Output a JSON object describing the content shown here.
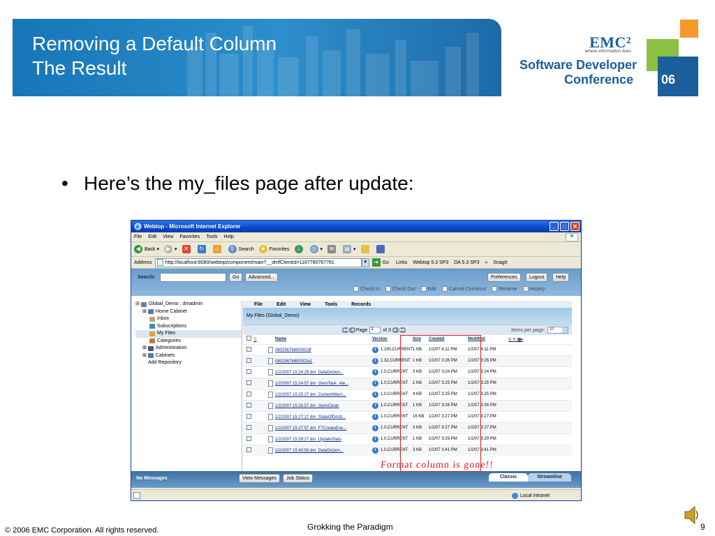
{
  "slide": {
    "title": "Removing a Default Column\nThe Result",
    "bullet": "Here’s the my_files page after update:",
    "annotation": "Format column is gone!!",
    "footer_copyright": "© 2006 EMC Corporation. All rights reserved.",
    "footer_center": "Grokking the Paradigm",
    "page_number": "9",
    "logo": {
      "brand": "EMC²",
      "tagline": "where information lives",
      "line1": "Software Developer",
      "line2": "Conference",
      "year": "06"
    }
  },
  "browser": {
    "title": "Webtop - Microsoft Internet Explorer",
    "menu": [
      "File",
      "Edit",
      "View",
      "Favorites",
      "Tools",
      "Help"
    ],
    "toolbar": {
      "back": "Back",
      "search": "Search",
      "favorites": "Favorites"
    },
    "address_label": "Address",
    "address": "http://localhost:8080/webtop/component/main?__dmfClientId=1167780767781",
    "go": "Go",
    "links_label": "Links",
    "links": [
      "Webtop 5.3 SP3",
      "DA 5.3 SP3",
      "SnagIt"
    ],
    "status_zone": "Local intranet"
  },
  "webtop": {
    "search_label": "Search:",
    "go_button": "Go",
    "advanced_button": "Advanced...",
    "preferences_button": "Preferences",
    "logout_button": "Logout",
    "help_button": "Help",
    "actions": [
      "Check In",
      "Check Out",
      "Edit",
      "Cancel Checkout",
      "Rename",
      "History"
    ],
    "tree": {
      "root": "Global_Demo : dmadmin",
      "items": [
        "Home Cabinet",
        "Inbox",
        "Subscriptions",
        "My Files",
        "Categories",
        "Administration",
        "Cabinets",
        "Add Repository"
      ]
    },
    "main_menu": [
      "File",
      "Edit",
      "View",
      "Tools",
      "Records"
    ],
    "breadcrumb": "My Files (Global_Demo)",
    "pager": {
      "page_label": "Page",
      "page_value": "1",
      "of_label": "of 3",
      "items_per_page_label": "Items per page:",
      "items_per_page": "10"
    },
    "columns": {
      "name": "Name",
      "version": "Version",
      "size": "Size",
      "created": "Created",
      "modified": "Modified"
    },
    "rows": [
      {
        "name": "08025676800002df",
        "version": "1.190,CURRENT",
        "size": "1 KB",
        "created": "1/2/07 4:11 PM",
        "modified": "1/2/07 4:11 PM"
      },
      {
        "name": "08025676800002e1",
        "version": "1.32,CURRENT",
        "size": "1 KB",
        "created": "1/2/07 3:26 PM",
        "modified": "1/2/07 3:26 PM"
      },
      {
        "name": "1/2/2007 15:24:29 dm_DataDiction...",
        "version": "1.0,CURRENT",
        "size": "3 KB",
        "created": "1/2/07 3:24 PM",
        "modified": "1/2/07 3:24 PM"
      },
      {
        "name": "1/2/2007 15:24:57 dm_GwmTask_Ale...",
        "version": "1.0,CURRENT",
        "size": "1 KB",
        "created": "1/2/07 3:25 PM",
        "modified": "1/2/07 3:25 PM"
      },
      {
        "name": "1/2/2007 15:25:27 dm_ContentWarn...",
        "version": "1.0,CURRENT",
        "size": "4 KB",
        "created": "1/2/07 3:25 PM",
        "modified": "1/2/07 3:25 PM"
      },
      {
        "name": "1/2/2007 15:26:57 dm_GwmClean",
        "version": "1.0,CURRENT",
        "size": "1 KB",
        "created": "1/2/07 3:26 PM",
        "modified": "1/2/07 3:26 PM"
      },
      {
        "name": "1/2/2007 15:27:27 dm_StateOfDocb...",
        "version": "1.0,CURRENT",
        "size": "16 KB",
        "created": "1/2/07 3:27 PM",
        "modified": "1/2/07 3:27 PM"
      },
      {
        "name": "1/2/2007 15:27:57 dm_FTCreateEve...",
        "version": "1.0,CURRENT",
        "size": "3 KB",
        "created": "1/2/07 3:27 PM",
        "modified": "1/2/07 3:27 PM"
      },
      {
        "name": "1/2/2007 15:29:27 dm_UpdateStats",
        "version": "1.0,CURRENT",
        "size": "1 KB",
        "created": "1/2/07 3:29 PM",
        "modified": "1/2/07 3:29 PM"
      },
      {
        "name": "1/2/2007 15:40:58 dm_DataDiction...",
        "version": "1.0,CURRENT",
        "size": "3 KB",
        "created": "1/2/07 3:41 PM",
        "modified": "1/2/07 3:41 PM"
      }
    ],
    "bottom": {
      "messages": "No Messages",
      "view_messages": "View Messages",
      "job_status": "Job Status",
      "tab_classic": "Classic",
      "tab_streamline": "Streamline"
    }
  }
}
